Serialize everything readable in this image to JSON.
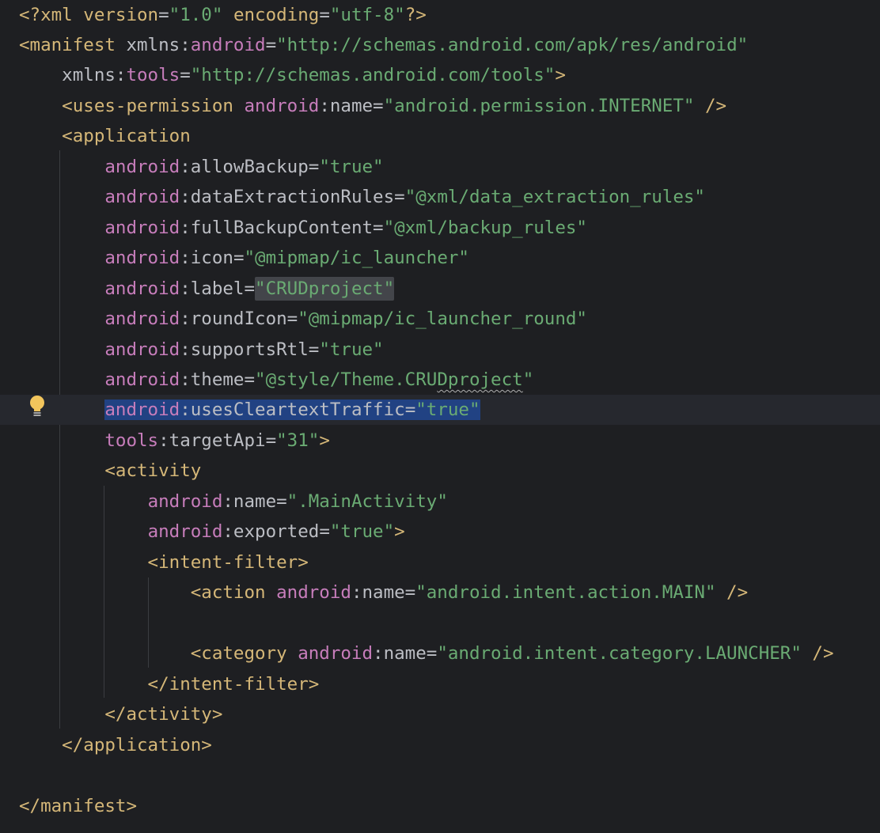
{
  "editor": {
    "language": "XML",
    "file": "AndroidManifest.xml"
  },
  "lines": [
    {
      "parts": [
        {
          "t": "<?",
          "c": "tag"
        },
        {
          "t": "xml version",
          "c": "tag"
        },
        {
          "t": "=",
          "c": "pun"
        },
        {
          "t": "\"1.0\"",
          "c": "val"
        },
        {
          "t": " ",
          "c": "pun"
        },
        {
          "t": "encoding",
          "c": "tag"
        },
        {
          "t": "=",
          "c": "pun"
        },
        {
          "t": "\"utf-8\"",
          "c": "val"
        },
        {
          "t": "?>",
          "c": "tag"
        }
      ]
    },
    {
      "parts": [
        {
          "t": "<manifest ",
          "c": "tag"
        },
        {
          "t": "xmlns:",
          "c": "attr"
        },
        {
          "t": "android",
          "c": "ns"
        },
        {
          "t": "=",
          "c": "pun"
        },
        {
          "t": "\"http://schemas.android.com/apk/res/android\"",
          "c": "val"
        }
      ]
    },
    {
      "parts": [
        {
          "t": "    xmlns:",
          "c": "attr"
        },
        {
          "t": "tools",
          "c": "ns"
        },
        {
          "t": "=",
          "c": "pun"
        },
        {
          "t": "\"http://schemas.android.com/tools\"",
          "c": "val"
        },
        {
          "t": ">",
          "c": "tag"
        }
      ]
    },
    {
      "parts": [
        {
          "t": "    <uses-permission ",
          "c": "tag"
        },
        {
          "t": "android",
          "c": "ns"
        },
        {
          "t": ":name",
          "c": "attr"
        },
        {
          "t": "=",
          "c": "pun"
        },
        {
          "t": "\"android.permission.INTERNET\"",
          "c": "val"
        },
        {
          "t": " />",
          "c": "tag"
        }
      ]
    },
    {
      "parts": [
        {
          "t": "    <application",
          "c": "tag"
        }
      ]
    },
    {
      "parts": [
        {
          "t": "        ",
          "c": "pun"
        },
        {
          "t": "android",
          "c": "ns"
        },
        {
          "t": ":allowBackup",
          "c": "attr"
        },
        {
          "t": "=",
          "c": "pun"
        },
        {
          "t": "\"true\"",
          "c": "val"
        }
      ]
    },
    {
      "parts": [
        {
          "t": "        ",
          "c": "pun"
        },
        {
          "t": "android",
          "c": "ns"
        },
        {
          "t": ":dataExtractionRules",
          "c": "attr"
        },
        {
          "t": "=",
          "c": "pun"
        },
        {
          "t": "\"@xml/data_extraction_rules\"",
          "c": "val"
        }
      ]
    },
    {
      "parts": [
        {
          "t": "        ",
          "c": "pun"
        },
        {
          "t": "android",
          "c": "ns"
        },
        {
          "t": ":fullBackupContent",
          "c": "attr"
        },
        {
          "t": "=",
          "c": "pun"
        },
        {
          "t": "\"@xml/backup_rules\"",
          "c": "val"
        }
      ]
    },
    {
      "parts": [
        {
          "t": "        ",
          "c": "pun"
        },
        {
          "t": "android",
          "c": "ns"
        },
        {
          "t": ":icon",
          "c": "attr"
        },
        {
          "t": "=",
          "c": "pun"
        },
        {
          "t": "\"@mipmap/ic_launcher\"",
          "c": "val"
        }
      ]
    },
    {
      "parts": [
        {
          "t": "        ",
          "c": "pun"
        },
        {
          "t": "android",
          "c": "ns"
        },
        {
          "t": ":label",
          "c": "attr"
        },
        {
          "t": "=",
          "c": "pun"
        },
        {
          "t": "\"CRUDproject\"",
          "c": "val",
          "x": "hl-label"
        }
      ]
    },
    {
      "parts": [
        {
          "t": "        ",
          "c": "pun"
        },
        {
          "t": "android",
          "c": "ns"
        },
        {
          "t": ":roundIcon",
          "c": "attr"
        },
        {
          "t": "=",
          "c": "pun"
        },
        {
          "t": "\"@mipmap/ic_launcher_round\"",
          "c": "val"
        }
      ]
    },
    {
      "parts": [
        {
          "t": "        ",
          "c": "pun"
        },
        {
          "t": "android",
          "c": "ns"
        },
        {
          "t": ":supportsRtl",
          "c": "attr"
        },
        {
          "t": "=",
          "c": "pun"
        },
        {
          "t": "\"true\"",
          "c": "val"
        }
      ]
    },
    {
      "parts": [
        {
          "t": "        ",
          "c": "pun"
        },
        {
          "t": "android",
          "c": "ns"
        },
        {
          "t": ":theme",
          "c": "attr"
        },
        {
          "t": "=",
          "c": "pun"
        },
        {
          "t": "\"@style/Theme.CRU",
          "c": "val"
        },
        {
          "t": "Dproject",
          "c": "val",
          "x": "squiggle"
        },
        {
          "t": "\"",
          "c": "val"
        }
      ]
    },
    {
      "current": true,
      "parts": [
        {
          "t": "        ",
          "c": "pun"
        },
        {
          "t": "android",
          "c": "ns",
          "x": "selection"
        },
        {
          "t": ":usesCleartextTraffic",
          "c": "attr",
          "x": "selection"
        },
        {
          "t": "=",
          "c": "pun",
          "x": "selection"
        },
        {
          "t": "\"true\"",
          "c": "val",
          "x": "selection"
        }
      ]
    },
    {
      "parts": [
        {
          "t": "        ",
          "c": "pun"
        },
        {
          "t": "tools",
          "c": "ns"
        },
        {
          "t": ":targetApi",
          "c": "attr"
        },
        {
          "t": "=",
          "c": "pun"
        },
        {
          "t": "\"31\"",
          "c": "val"
        },
        {
          "t": ">",
          "c": "tag"
        }
      ]
    },
    {
      "parts": [
        {
          "t": "        <activity",
          "c": "tag"
        }
      ]
    },
    {
      "parts": [
        {
          "t": "            ",
          "c": "pun"
        },
        {
          "t": "android",
          "c": "ns"
        },
        {
          "t": ":name",
          "c": "attr"
        },
        {
          "t": "=",
          "c": "pun"
        },
        {
          "t": "\".MainActivity\"",
          "c": "val"
        }
      ]
    },
    {
      "parts": [
        {
          "t": "            ",
          "c": "pun"
        },
        {
          "t": "android",
          "c": "ns"
        },
        {
          "t": ":exported",
          "c": "attr"
        },
        {
          "t": "=",
          "c": "pun"
        },
        {
          "t": "\"true\"",
          "c": "val"
        },
        {
          "t": ">",
          "c": "tag"
        }
      ]
    },
    {
      "parts": [
        {
          "t": "            <intent-filter>",
          "c": "tag"
        }
      ]
    },
    {
      "parts": [
        {
          "t": "                <action ",
          "c": "tag"
        },
        {
          "t": "android",
          "c": "ns"
        },
        {
          "t": ":name",
          "c": "attr"
        },
        {
          "t": "=",
          "c": "pun"
        },
        {
          "t": "\"android.intent.action.MAIN\"",
          "c": "val"
        },
        {
          "t": " />",
          "c": "tag"
        }
      ]
    },
    {
      "parts": []
    },
    {
      "parts": [
        {
          "t": "                <category ",
          "c": "tag"
        },
        {
          "t": "android",
          "c": "ns"
        },
        {
          "t": ":name",
          "c": "attr"
        },
        {
          "t": "=",
          "c": "pun"
        },
        {
          "t": "\"android.intent.category.LAUNCHER\"",
          "c": "val"
        },
        {
          "t": " />",
          "c": "tag"
        }
      ]
    },
    {
      "parts": [
        {
          "t": "            </intent-filter>",
          "c": "tag"
        }
      ]
    },
    {
      "parts": [
        {
          "t": "        </activity>",
          "c": "tag"
        }
      ]
    },
    {
      "parts": [
        {
          "t": "    </application>",
          "c": "tag"
        }
      ]
    },
    {
      "parts": []
    },
    {
      "parts": [
        {
          "t": "</manifest>",
          "c": "tag"
        }
      ]
    }
  ],
  "gutter": {
    "intention_icon": "lightbulb-icon"
  },
  "colors": {
    "background": "#1e1f22",
    "tag": "#d5b778",
    "namespace": "#c77dbb",
    "value": "#6aab73",
    "text": "#bcbec4",
    "selection": "#214283"
  }
}
